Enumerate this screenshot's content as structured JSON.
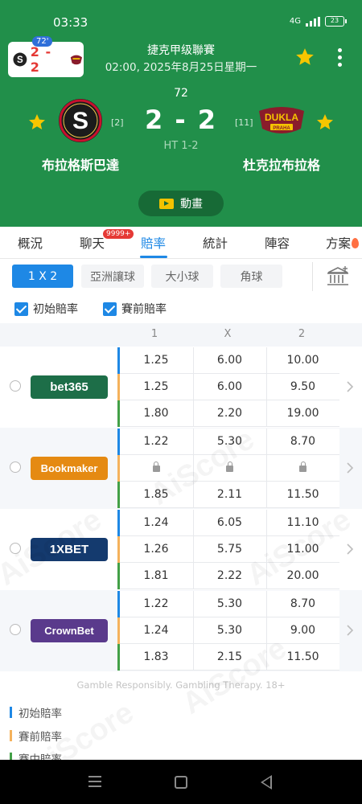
{
  "status_bar": {
    "time": "03:33",
    "network": "4G",
    "battery": "23"
  },
  "mini_card": {
    "minute": "72'",
    "score": "2 - 2"
  },
  "match": {
    "league": "捷克甲级聯賽",
    "datetime": "02:00, 2025年8月25日星期一",
    "minute": "72",
    "score": "2 - 2",
    "halftime": "HT 1-2",
    "home": {
      "name": "布拉格斯巴達",
      "rank": "[2]"
    },
    "away": {
      "name": "杜克拉布拉格",
      "rank": "[11]",
      "logo_text": "DUKLA",
      "logo_sub": "PRAHA"
    },
    "animation_label": "動畫"
  },
  "tabs": [
    {
      "label": "概況"
    },
    {
      "label": "聊天",
      "badge": "9999+"
    },
    {
      "label": "賠率",
      "active": true
    },
    {
      "label": "統計"
    },
    {
      "label": "陣容"
    },
    {
      "label": "方案"
    }
  ],
  "filters": {
    "options": [
      "1 X 2",
      "亞洲讓球",
      "大小球",
      "角球"
    ],
    "selected": "1 X 2"
  },
  "checkboxes": [
    {
      "label": "初始賠率",
      "checked": true
    },
    {
      "label": "賽前賠率",
      "checked": true
    }
  ],
  "table": {
    "columns": [
      "1",
      "X",
      "2"
    ],
    "bookmakers": [
      {
        "name": "bet365",
        "logo_color": "#1d6e48",
        "text_color": "#ffffff",
        "logo_accent": "#f5cc00",
        "rows": [
          [
            "1.25",
            "6.00",
            "10.00"
          ],
          [
            "1.25",
            "6.00",
            "9.50"
          ],
          [
            "1.80",
            "2.20",
            "19.00"
          ]
        ]
      },
      {
        "name": "Bookmaker",
        "logo_color": "#e58a12",
        "text_color": "#ffffff",
        "rows": [
          [
            "1.22",
            "5.30",
            "8.70"
          ],
          [
            "lock",
            "lock",
            "lock"
          ],
          [
            "1.85",
            "2.11",
            "11.50"
          ]
        ]
      },
      {
        "name": "1XBET",
        "logo_color": "#143a6e",
        "text_color": "#ffffff",
        "rows": [
          [
            "1.24",
            "6.05",
            "11.10"
          ],
          [
            "1.26",
            "5.75",
            "11.00"
          ],
          [
            "1.81",
            "2.22",
            "20.00"
          ]
        ]
      },
      {
        "name": "CrownBet",
        "logo_color": "#5a3a8c",
        "text_color": "#ffffff",
        "rows": [
          [
            "1.22",
            "5.30",
            "8.70"
          ],
          [
            "1.24",
            "5.30",
            "9.00"
          ],
          [
            "1.83",
            "2.15",
            "11.50"
          ]
        ]
      }
    ]
  },
  "disclaimer": "Gamble Responsibly. Gambling Therapy. 18+",
  "legend": [
    {
      "label": "初始賠率",
      "color": "#1e88e5"
    },
    {
      "label": "賽前賠率",
      "color": "#f5b25c"
    },
    {
      "label": "賽中賠率",
      "color": "#43a047"
    }
  ],
  "watermark": "AiScore",
  "colors": {
    "header_bg": "#218f4a",
    "accent": "#1e88e5",
    "star": "#f7c600",
    "score_red": "#e53935"
  }
}
